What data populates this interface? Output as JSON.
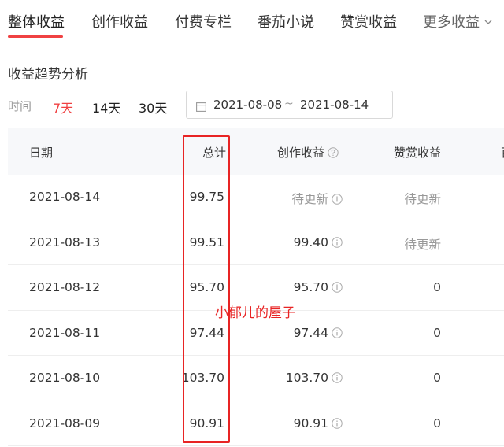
{
  "tabs": [
    {
      "label": "整体收益",
      "active": true
    },
    {
      "label": "创作收益",
      "active": false
    },
    {
      "label": "付费专栏",
      "active": false
    },
    {
      "label": "番茄小说",
      "active": false
    },
    {
      "label": "赞赏收益",
      "active": false
    },
    {
      "label": "更多收益",
      "active": false
    }
  ],
  "section_title": "收益趋势分析",
  "time_filter": {
    "label": "时间",
    "options": [
      "7天",
      "14天",
      "30天"
    ],
    "selected": "7天"
  },
  "date_range": {
    "start": "2021-08-08",
    "separator": "~",
    "end": "2021-08-14"
  },
  "table": {
    "headers": {
      "date": "日期",
      "total": "总计",
      "creation": "创作收益",
      "appreciation": "赞赏收益",
      "clipped": "百"
    },
    "rows": [
      {
        "date": "2021-08-14",
        "total": "99.75",
        "creation": "待更新",
        "appreciation": "待更新"
      },
      {
        "date": "2021-08-13",
        "total": "99.51",
        "creation": "99.40",
        "appreciation": "待更新"
      },
      {
        "date": "2021-08-12",
        "total": "95.70",
        "creation": "95.70",
        "appreciation": "0"
      },
      {
        "date": "2021-08-11",
        "total": "97.44",
        "creation": "97.44",
        "appreciation": "0"
      },
      {
        "date": "2021-08-10",
        "total": "103.70",
        "creation": "103.70",
        "appreciation": "0"
      },
      {
        "date": "2021-08-09",
        "total": "90.91",
        "creation": "90.91",
        "appreciation": "0"
      }
    ]
  },
  "watermark": "小郁儿的屋子",
  "colors": {
    "accent": "#f04142",
    "highlight": "#e82424",
    "pending_text": "#999999",
    "header_bg": "#f7f8fa"
  },
  "icons": {
    "tab_more": "chevron-down-icon",
    "date_picker": "calendar-icon",
    "creation_header": "help-icon",
    "creation_cells": "info-icon"
  }
}
